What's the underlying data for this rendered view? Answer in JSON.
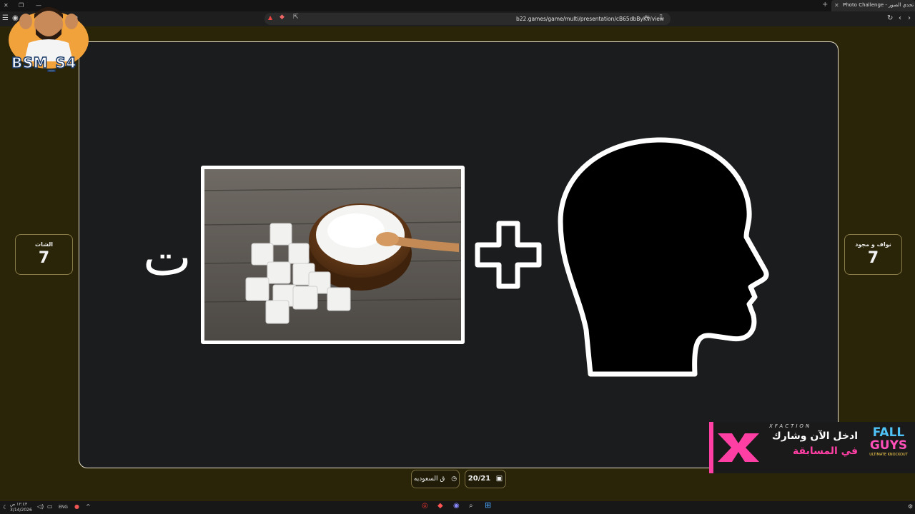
{
  "browser": {
    "tab_title": "Photo Challenge - تحدي الصور",
    "url": "b22.games/game/multi/presentation/cB65dbByKv/view"
  },
  "streamer": {
    "name": "BSM_S4"
  },
  "teams": {
    "left": {
      "name": "الشات",
      "score": "7"
    },
    "right": {
      "name": "نواف و مجود",
      "score": "7"
    }
  },
  "puzzle": {
    "letter": "ت"
  },
  "footer": {
    "category_label": "ق السعوديه",
    "progress_label": "20/21"
  },
  "banner": {
    "brand": "XFACTION",
    "line1": "ادخل الآن وشارك",
    "line2": "في المسابقة",
    "game_top": "FALL",
    "game_bottom": "GUYS",
    "game_sub": "ULTIMATE KNOCKOUT"
  },
  "taskbar": {
    "time": "١٢:٤٣ ص",
    "date": "3/14/2026",
    "lang": "ENG"
  },
  "colors": {
    "background": "#2a2508",
    "stage": "#1b1c1e",
    "accent_gold": "#8a7c4a",
    "banner_pink": "#ff3fa4"
  }
}
